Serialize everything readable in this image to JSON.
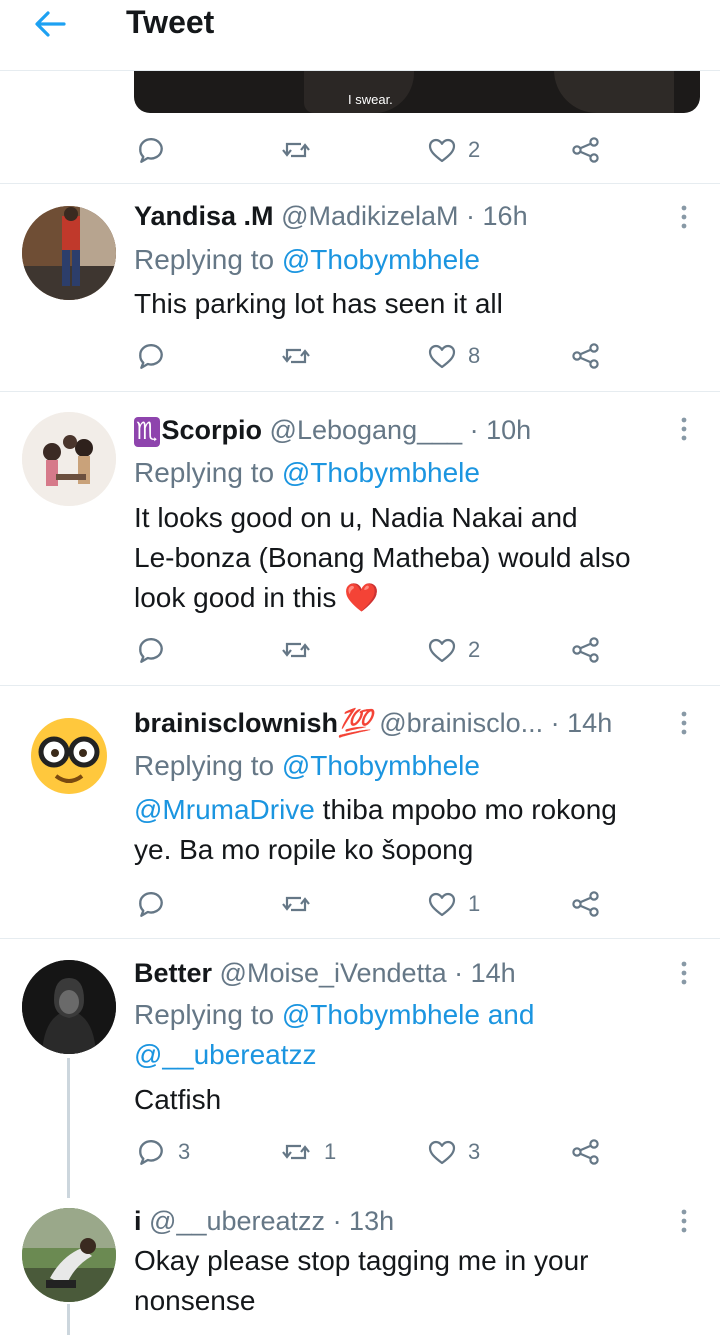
{
  "header": {
    "title": "Tweet"
  },
  "media": {
    "caption": "I swear."
  },
  "top_actions": {
    "like_count": "2"
  },
  "replies": [
    {
      "name": "Yandisa .M",
      "handle": "@MadikizelaM",
      "time": "· 16h",
      "replying_prefix": "Replying to",
      "replying_to": "@Thobymbhele",
      "text": "This parking lot has seen it all",
      "like_count": "8"
    },
    {
      "name_emoji": "♏",
      "name": "Scorpio",
      "handle": "@Lebogang___",
      "time": "· 10h",
      "replying_prefix": "Replying to",
      "replying_to": "@Thobymbhele",
      "text_line1": "It looks good on u, Nadia Nakai and",
      "text_line2": "Le-bonza (Bonang Matheba) would also",
      "text_line3": "look good in this",
      "text_emoji": "❤️",
      "like_count": "2"
    },
    {
      "name": "brainisclownish",
      "name_emoji": "💯",
      "handle": "@brainisclo...",
      "time": "· 14h",
      "replying_prefix": "Replying to",
      "replying_to": "@Thobymbhele",
      "mention": "@MrumaDrive",
      "text_line1": " thiba mpobo mo rokong",
      "text_line2": "ye. Ba mo ropile ko šopong",
      "like_count": "1"
    },
    {
      "name": "Better",
      "handle": "@Moise_iVendetta",
      "time": "· 14h",
      "replying_prefix": "Replying to",
      "replying_to": "@Thobymbhele and",
      "replying_to2": "@__ubereatzz",
      "text": "Catfish",
      "reply_count": "3",
      "retweet_count": "1",
      "like_count": "3"
    },
    {
      "name": "i",
      "handle": "@__ubereatzz",
      "time": "· 13h",
      "text_line1": "Okay please stop tagging me in your",
      "text_line2": "nonsense"
    }
  ],
  "icons": {
    "back": "arrow-left-icon",
    "reply": "speech-bubble-icon",
    "retweet": "retweet-icon",
    "like": "heart-icon",
    "share": "share-icon",
    "more": "vertical-dots-icon"
  },
  "colors": {
    "accent": "#1da1f2",
    "link": "#1b95e0",
    "muted": "#657786",
    "divider": "#e6ecf0"
  }
}
